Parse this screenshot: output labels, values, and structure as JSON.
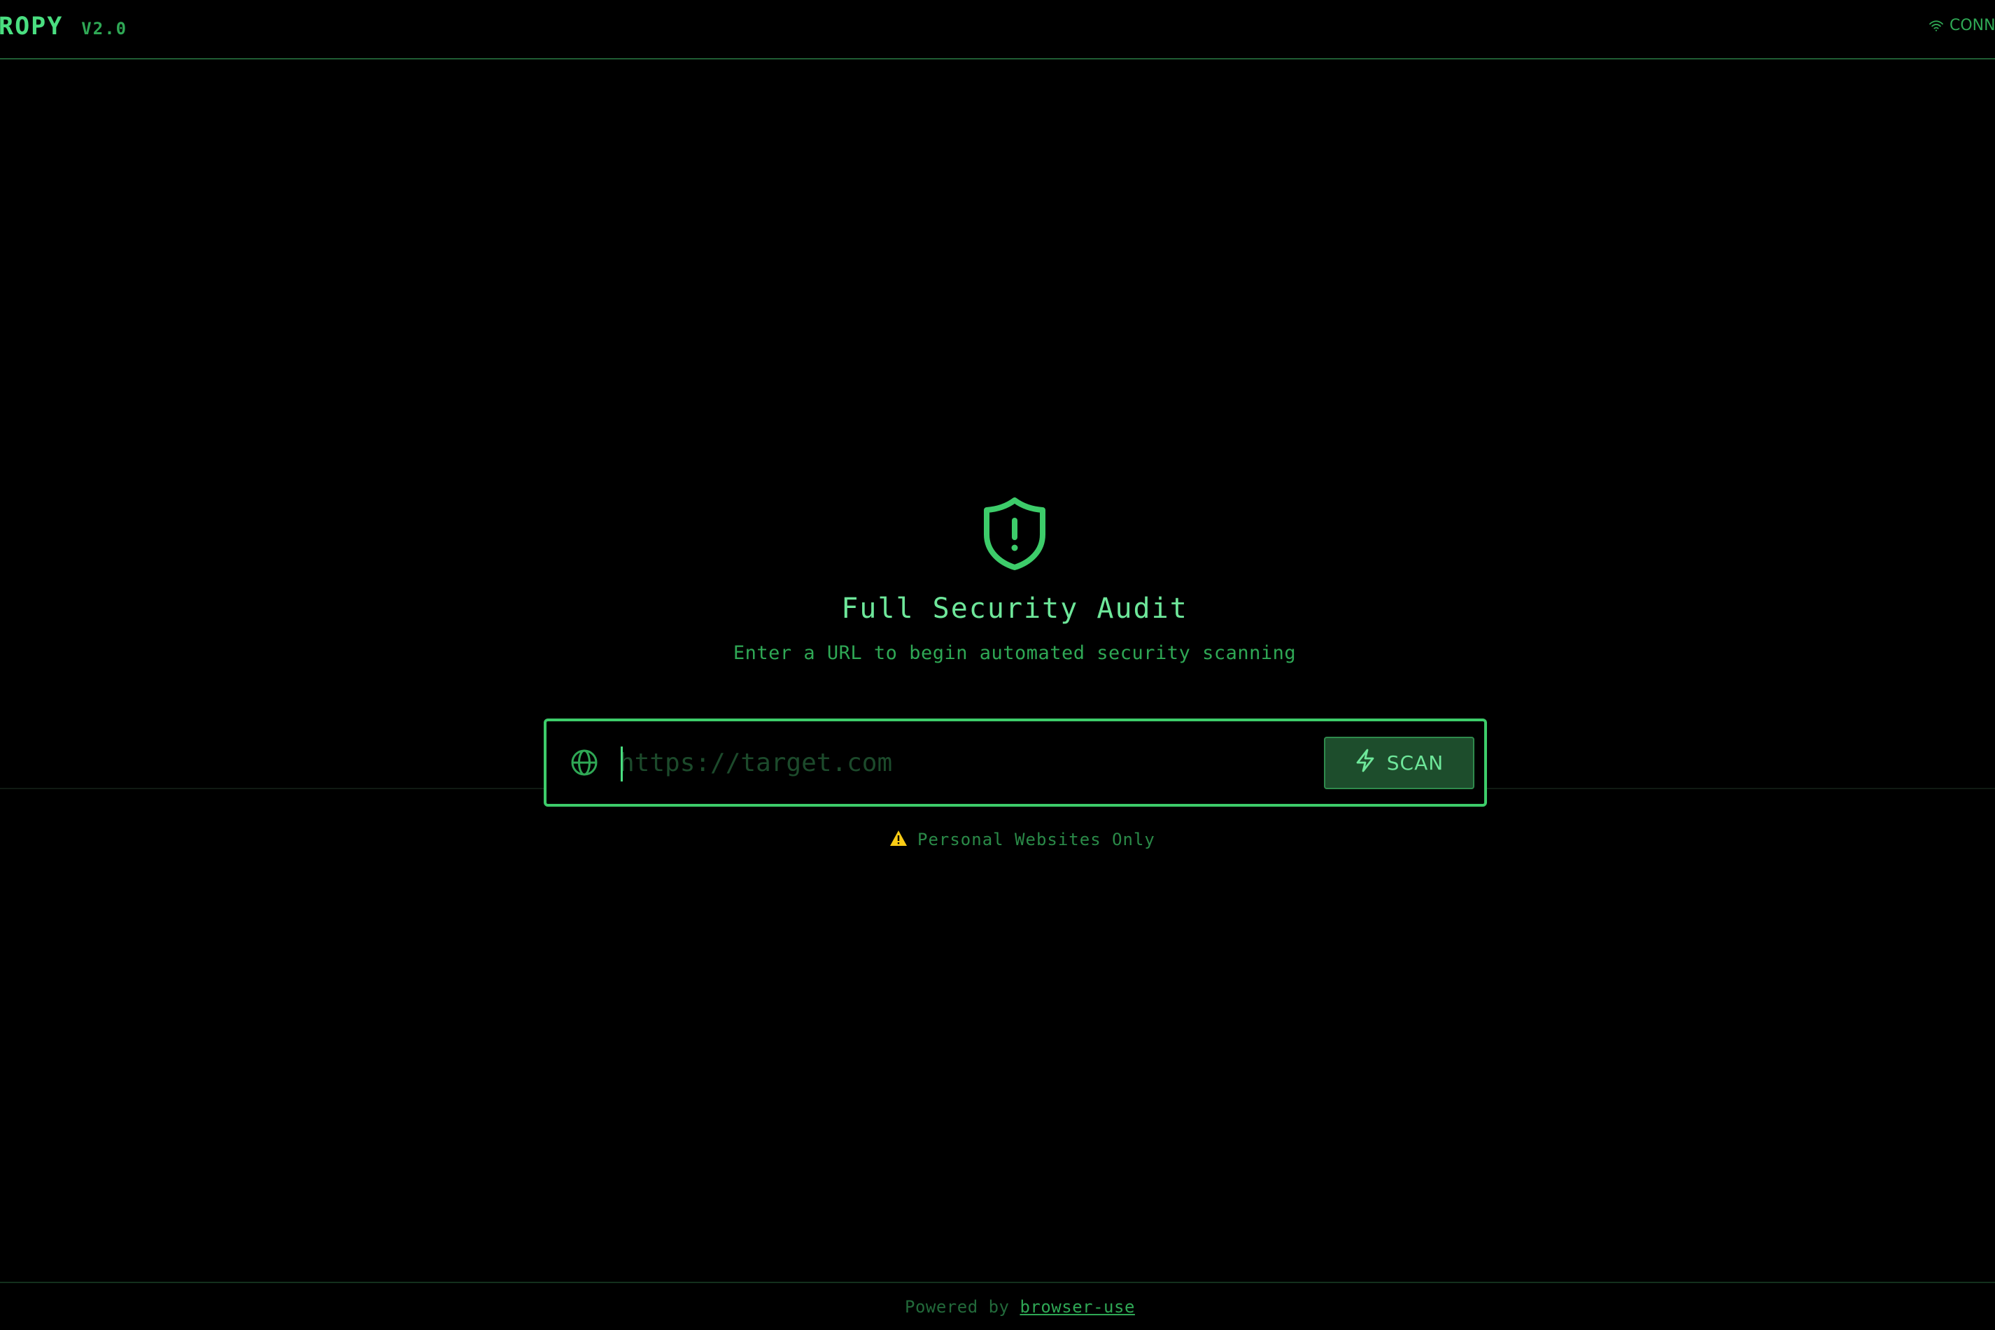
{
  "header": {
    "brand_name": "ROPY",
    "brand_version": "V2.0",
    "status_label": "CONN",
    "status_icon": "wifi-icon"
  },
  "hero": {
    "icon": "shield-alert-icon",
    "title": "Full Security Audit",
    "subtitle": "Enter a URL to begin automated security scanning"
  },
  "search": {
    "icon": "globe-icon",
    "placeholder": "https://target.com",
    "value": "",
    "scan_icon": "lightning-icon",
    "scan_label": "SCAN"
  },
  "warning": {
    "icon": "warning-triangle-icon",
    "text": "Personal Websites Only"
  },
  "footer": {
    "prefix": "Powered by",
    "link_text": "browser-use"
  },
  "colors": {
    "background": "#000000",
    "accent": "#4ade80",
    "accent_dim": "#2fa855",
    "button_bg": "#1d4d2c",
    "warning": "#facc15"
  }
}
